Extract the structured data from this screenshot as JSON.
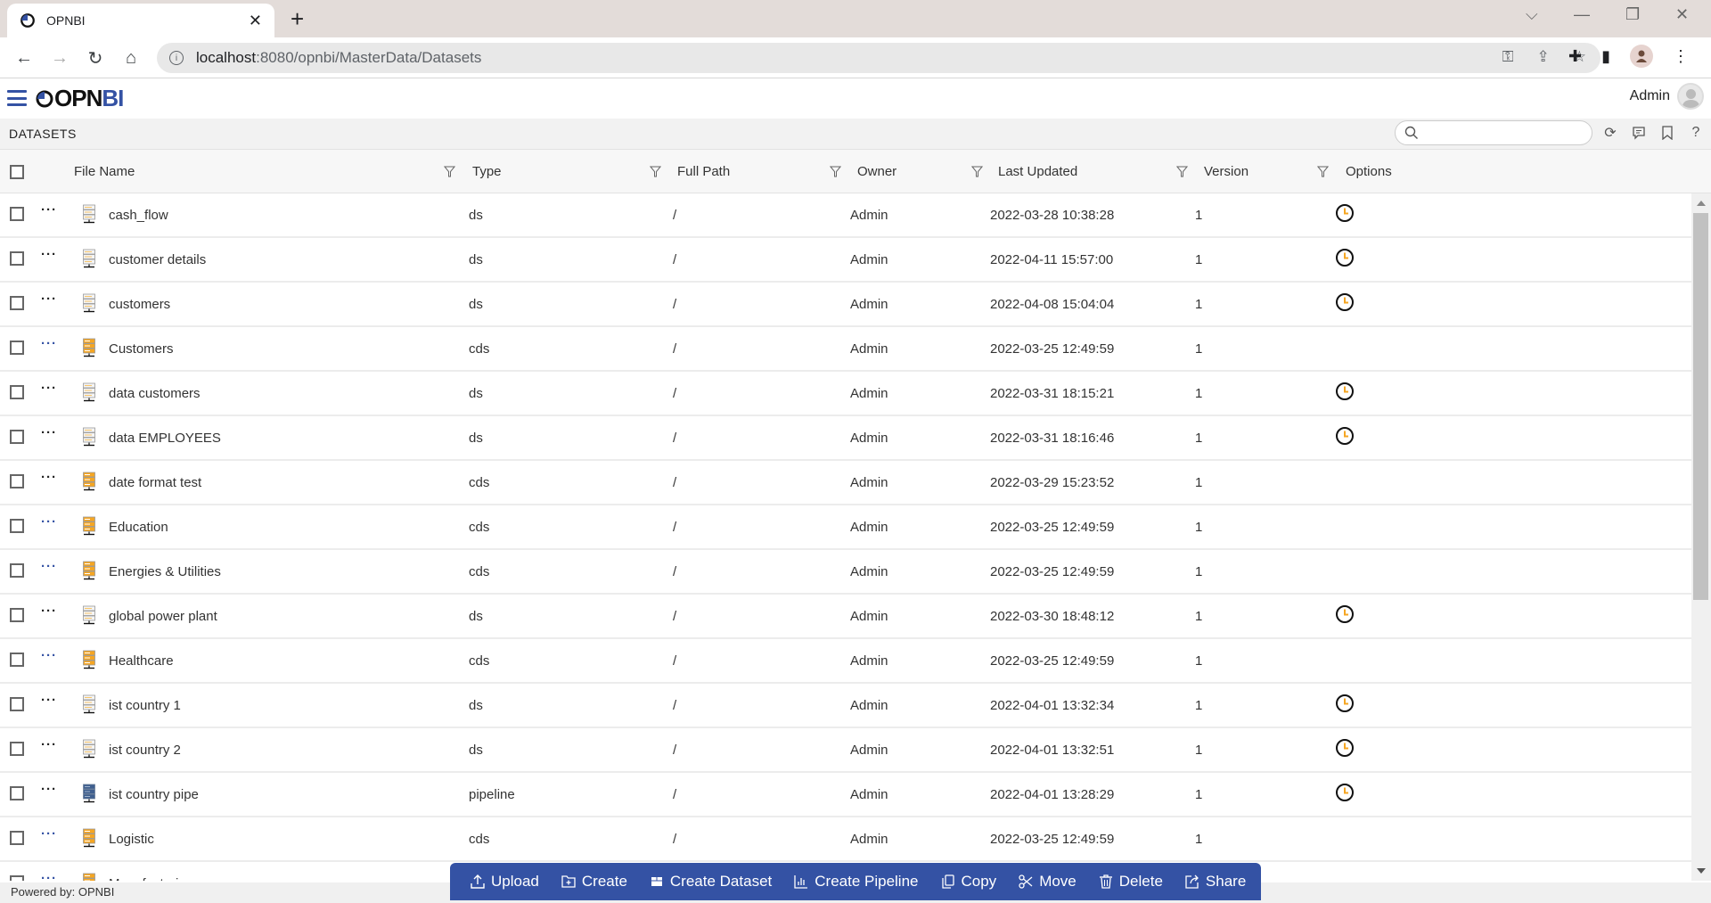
{
  "browser": {
    "tab_title": "OPNBI",
    "url_host": "localhost",
    "url_path": ":8080/opnbi/MasterData/Datasets"
  },
  "app": {
    "logo_dark": "OPN",
    "logo_accent": "BI",
    "user_name": "Admin",
    "accent_color": "#3452a4"
  },
  "page": {
    "title": "DATASETS",
    "search_placeholder": "",
    "search_value": ""
  },
  "table": {
    "columns": [
      "File Name",
      "Type",
      "Full Path",
      "Owner",
      "Last Updated",
      "Version",
      "Options"
    ],
    "rows": [
      {
        "name": "cash_flow",
        "type": "ds",
        "path": "/",
        "owner": "Admin",
        "updated": "2022-03-28 10:38:28",
        "version": "1",
        "schedule": true,
        "dots": "black"
      },
      {
        "name": "customer details",
        "type": "ds",
        "path": "/",
        "owner": "Admin",
        "updated": "2022-04-11 15:57:00",
        "version": "1",
        "schedule": true,
        "dots": "black"
      },
      {
        "name": "customers",
        "type": "ds",
        "path": "/",
        "owner": "Admin",
        "updated": "2022-04-08 15:04:04",
        "version": "1",
        "schedule": true,
        "dots": "black"
      },
      {
        "name": "Customers",
        "type": "cds",
        "path": "/",
        "owner": "Admin",
        "updated": "2022-03-25 12:49:59",
        "version": "1",
        "schedule": false,
        "dots": "blue"
      },
      {
        "name": "data customers",
        "type": "ds",
        "path": "/",
        "owner": "Admin",
        "updated": "2022-03-31 18:15:21",
        "version": "1",
        "schedule": true,
        "dots": "black"
      },
      {
        "name": "data EMPLOYEES",
        "type": "ds",
        "path": "/",
        "owner": "Admin",
        "updated": "2022-03-31 18:16:46",
        "version": "1",
        "schedule": true,
        "dots": "black"
      },
      {
        "name": "date format test",
        "type": "cds",
        "path": "/",
        "owner": "Admin",
        "updated": "2022-03-29 15:23:52",
        "version": "1",
        "schedule": false,
        "dots": "black"
      },
      {
        "name": "Education",
        "type": "cds",
        "path": "/",
        "owner": "Admin",
        "updated": "2022-03-25 12:49:59",
        "version": "1",
        "schedule": false,
        "dots": "blue"
      },
      {
        "name": "Energies & Utilities",
        "type": "cds",
        "path": "/",
        "owner": "Admin",
        "updated": "2022-03-25 12:49:59",
        "version": "1",
        "schedule": false,
        "dots": "blue"
      },
      {
        "name": "global power plant",
        "type": "ds",
        "path": "/",
        "owner": "Admin",
        "updated": "2022-03-30 18:48:12",
        "version": "1",
        "schedule": true,
        "dots": "black"
      },
      {
        "name": "Healthcare",
        "type": "cds",
        "path": "/",
        "owner": "Admin",
        "updated": "2022-03-25 12:49:59",
        "version": "1",
        "schedule": false,
        "dots": "blue"
      },
      {
        "name": "ist country 1",
        "type": "ds",
        "path": "/",
        "owner": "Admin",
        "updated": "2022-04-01 13:32:34",
        "version": "1",
        "schedule": true,
        "dots": "black"
      },
      {
        "name": "ist country 2",
        "type": "ds",
        "path": "/",
        "owner": "Admin",
        "updated": "2022-04-01 13:32:51",
        "version": "1",
        "schedule": true,
        "dots": "black"
      },
      {
        "name": "ist country pipe",
        "type": "pipeline",
        "path": "/",
        "owner": "Admin",
        "updated": "2022-04-01 13:28:29",
        "version": "1",
        "schedule": true,
        "dots": "black"
      },
      {
        "name": "Logistic",
        "type": "cds",
        "path": "/",
        "owner": "Admin",
        "updated": "2022-03-25 12:49:59",
        "version": "1",
        "schedule": false,
        "dots": "blue"
      },
      {
        "name": "Manufacturing",
        "type": "",
        "path": "",
        "owner": "",
        "updated": "",
        "version": "",
        "schedule": false,
        "dots": "blue"
      }
    ]
  },
  "actions": [
    {
      "id": "upload",
      "label": "Upload",
      "icon": "upload-icon"
    },
    {
      "id": "create",
      "label": "Create",
      "icon": "create-icon"
    },
    {
      "id": "create-dataset",
      "label": "Create Dataset",
      "icon": "dataset-icon"
    },
    {
      "id": "create-pipeline",
      "label": "Create Pipeline",
      "icon": "pipeline-icon"
    },
    {
      "id": "copy",
      "label": "Copy",
      "icon": "copy-icon"
    },
    {
      "id": "move",
      "label": "Move",
      "icon": "scissors-icon"
    },
    {
      "id": "delete",
      "label": "Delete",
      "icon": "trash-icon"
    },
    {
      "id": "share",
      "label": "Share",
      "icon": "share-icon"
    }
  ],
  "footer": {
    "text": "Powered by: OPNBI"
  }
}
